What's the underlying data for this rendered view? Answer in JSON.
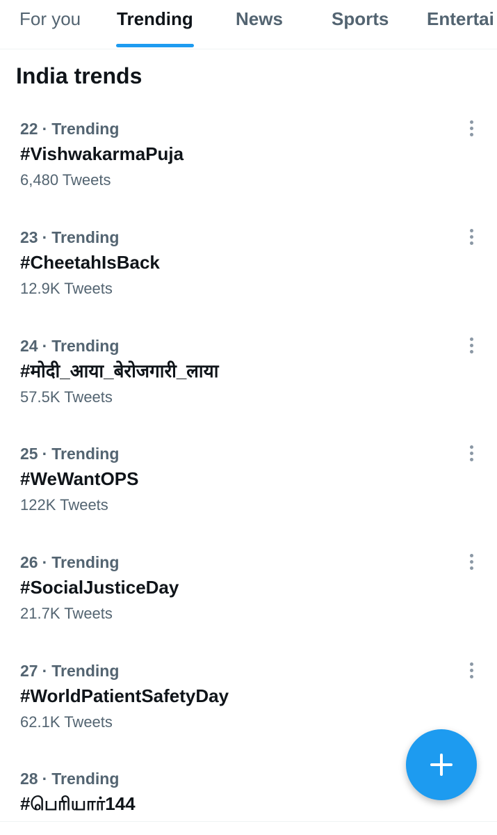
{
  "tabs": [
    {
      "label": "For you"
    },
    {
      "label": "Trending",
      "active": true
    },
    {
      "label": "News"
    },
    {
      "label": "Sports"
    },
    {
      "label": "Entertai"
    }
  ],
  "section_title": "India trends",
  "trends": [
    {
      "rank": "22",
      "category": "Trending",
      "name": "#VishwakarmaPuja",
      "count": "6,480 Tweets"
    },
    {
      "rank": "23",
      "category": "Trending",
      "name": "#CheetahIsBack",
      "count": "12.9K Tweets"
    },
    {
      "rank": "24",
      "category": "Trending",
      "name": "#मोदी_आया_बेरोजगारी_लाया",
      "count": "57.5K Tweets"
    },
    {
      "rank": "25",
      "category": "Trending",
      "name": "#WeWantOPS",
      "count": "122K Tweets"
    },
    {
      "rank": "26",
      "category": "Trending",
      "name": "#SocialJusticeDay",
      "count": "21.7K Tweets"
    },
    {
      "rank": "27",
      "category": "Trending",
      "name": "#WorldPatientSafetyDay",
      "count": "62.1K Tweets"
    },
    {
      "rank": "28",
      "category": "Trending",
      "name": "#பெரியார்144",
      "count": ""
    }
  ],
  "icons": {
    "more": "more-vertical-icon",
    "compose": "plus-icon"
  },
  "colors": {
    "accent": "#1d9bf0",
    "text_primary": "#0f1419",
    "text_secondary": "#536471"
  }
}
